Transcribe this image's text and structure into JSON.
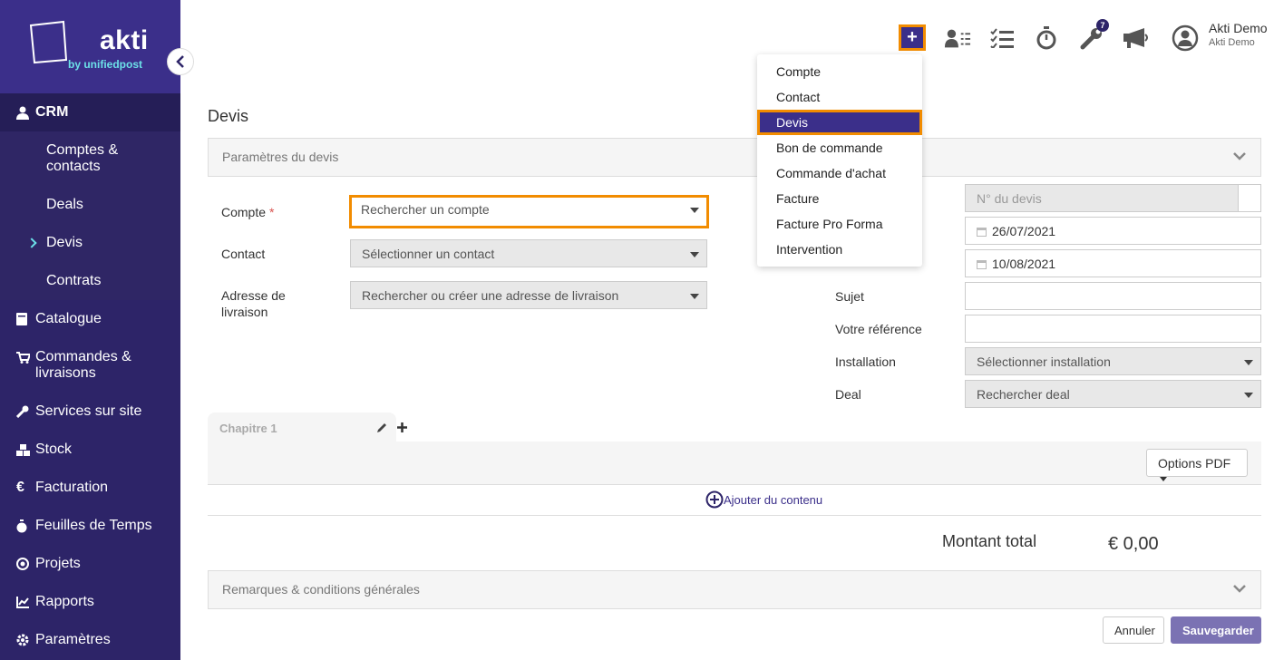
{
  "brand": {
    "name": "akti",
    "tagline": "by unifiedpost"
  },
  "sidebar": {
    "crm_label": "CRM",
    "crm_sub": [
      {
        "label": "Comptes &\ncontacts"
      },
      {
        "label": "Deals"
      },
      {
        "label": "Devis"
      },
      {
        "label": "Contrats"
      }
    ],
    "items": [
      {
        "label": "Catalogue",
        "icon": "book-icon"
      },
      {
        "label": "Commandes &\nlivraisons",
        "icon": "cart-icon"
      },
      {
        "label": "Services sur site",
        "icon": "wrench-icon"
      },
      {
        "label": "Stock",
        "icon": "boxes-icon"
      },
      {
        "label": "Facturation",
        "icon": "euro-icon"
      },
      {
        "label": "Feuilles de Temps",
        "icon": "stopwatch-icon"
      },
      {
        "label": "Projets",
        "icon": "target-icon"
      },
      {
        "label": "Rapports",
        "icon": "chart-icon"
      },
      {
        "label": "Paramètres",
        "icon": "gear-icon"
      }
    ]
  },
  "topbar": {
    "plus_label": "+",
    "badge_count": "7",
    "user_name": "Akti Demo",
    "user_company": "Akti Demo"
  },
  "create_menu": {
    "items": [
      "Compte",
      "Contact",
      "Devis",
      "Bon de commande",
      "Commande d'achat",
      "Facture",
      "Facture Pro Forma",
      "Intervention"
    ],
    "active": "Devis"
  },
  "page": {
    "title": "Devis",
    "params_header": "Paramètres du devis",
    "left_form": {
      "compte_label": "Compte",
      "compte_required": "*",
      "compte_placeholder": "Rechercher un compte",
      "contact_label": "Contact",
      "contact_placeholder": "Sélectionner un contact",
      "adresse_label": "Adresse de\nlivraison",
      "adresse_placeholder": "Rechercher ou créer une adresse de livraison"
    },
    "right_form": {
      "numero_placeholder": "N° du devis",
      "date1": "26/07/2021",
      "date2": "10/08/2021",
      "sujet_label": "Sujet",
      "sujet_value": "",
      "reference_label": "Votre référence",
      "reference_value": "",
      "installation_label": "Installation",
      "installation_placeholder": "Sélectionner installation",
      "deal_label": "Deal",
      "deal_placeholder": "Rechercher deal"
    },
    "chapter": {
      "name": "Chapitre 1"
    },
    "options_pdf": "Options PDF",
    "add_content": "Ajouter du contenu",
    "total_label": "Montant total",
    "total_value": "€ 0,00",
    "remarks_header": "Remarques & conditions générales",
    "cancel_label": "Annuler",
    "save_label": "Sauvegarder"
  },
  "colors": {
    "sidebar": "#2d2468",
    "accent": "#3b2f8a",
    "highlight": "#f28c00",
    "teal": "#6ce0e8"
  }
}
